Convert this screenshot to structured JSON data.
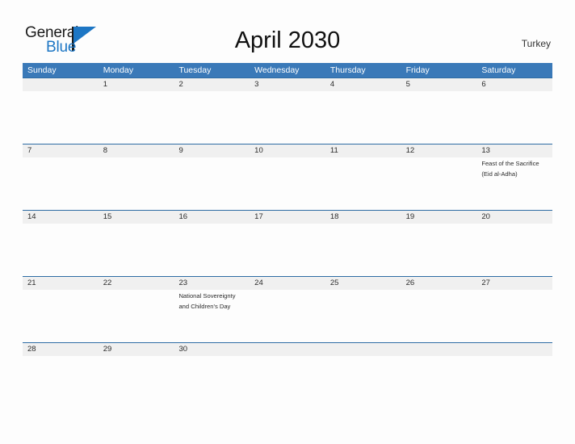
{
  "branding": {
    "logo_primary": "General",
    "logo_secondary": "Blue",
    "logo_triangle_color": "#1d76c4"
  },
  "header": {
    "title": "April 2030",
    "region": "Turkey"
  },
  "theme": {
    "header_blue": "#3a79b8",
    "divider_blue": "#2e6ca4",
    "daynum_band": "#f0f0f0",
    "page_background": "#fdfdfd",
    "text": "#2b2b2b"
  },
  "calendar": {
    "month": "April",
    "year": "2030",
    "weekday_headers": [
      {
        "label": "Sunday"
      },
      {
        "label": "Monday"
      },
      {
        "label": "Tuesday"
      },
      {
        "label": "Wednesday"
      },
      {
        "label": "Thursday"
      },
      {
        "label": "Friday"
      },
      {
        "label": "Saturday"
      }
    ],
    "weeks": [
      {
        "days": [
          {
            "num": "",
            "event": ""
          },
          {
            "num": "1",
            "event": ""
          },
          {
            "num": "2",
            "event": ""
          },
          {
            "num": "3",
            "event": ""
          },
          {
            "num": "4",
            "event": ""
          },
          {
            "num": "5",
            "event": ""
          },
          {
            "num": "6",
            "event": ""
          }
        ]
      },
      {
        "days": [
          {
            "num": "7",
            "event": ""
          },
          {
            "num": "8",
            "event": ""
          },
          {
            "num": "9",
            "event": ""
          },
          {
            "num": "10",
            "event": ""
          },
          {
            "num": "11",
            "event": ""
          },
          {
            "num": "12",
            "event": ""
          },
          {
            "num": "13",
            "event": "Feast of the Sacrifice (Eid al-Adha)"
          }
        ]
      },
      {
        "days": [
          {
            "num": "14",
            "event": ""
          },
          {
            "num": "15",
            "event": ""
          },
          {
            "num": "16",
            "event": ""
          },
          {
            "num": "17",
            "event": ""
          },
          {
            "num": "18",
            "event": ""
          },
          {
            "num": "19",
            "event": ""
          },
          {
            "num": "20",
            "event": ""
          }
        ]
      },
      {
        "days": [
          {
            "num": "21",
            "event": ""
          },
          {
            "num": "22",
            "event": ""
          },
          {
            "num": "23",
            "event": "National Sovereignty and Children's Day"
          },
          {
            "num": "24",
            "event": ""
          },
          {
            "num": "25",
            "event": ""
          },
          {
            "num": "26",
            "event": ""
          },
          {
            "num": "27",
            "event": ""
          }
        ]
      },
      {
        "days": [
          {
            "num": "28",
            "event": ""
          },
          {
            "num": "29",
            "event": ""
          },
          {
            "num": "30",
            "event": ""
          },
          {
            "num": "",
            "event": ""
          },
          {
            "num": "",
            "event": ""
          },
          {
            "num": "",
            "event": ""
          },
          {
            "num": "",
            "event": ""
          }
        ]
      }
    ]
  }
}
